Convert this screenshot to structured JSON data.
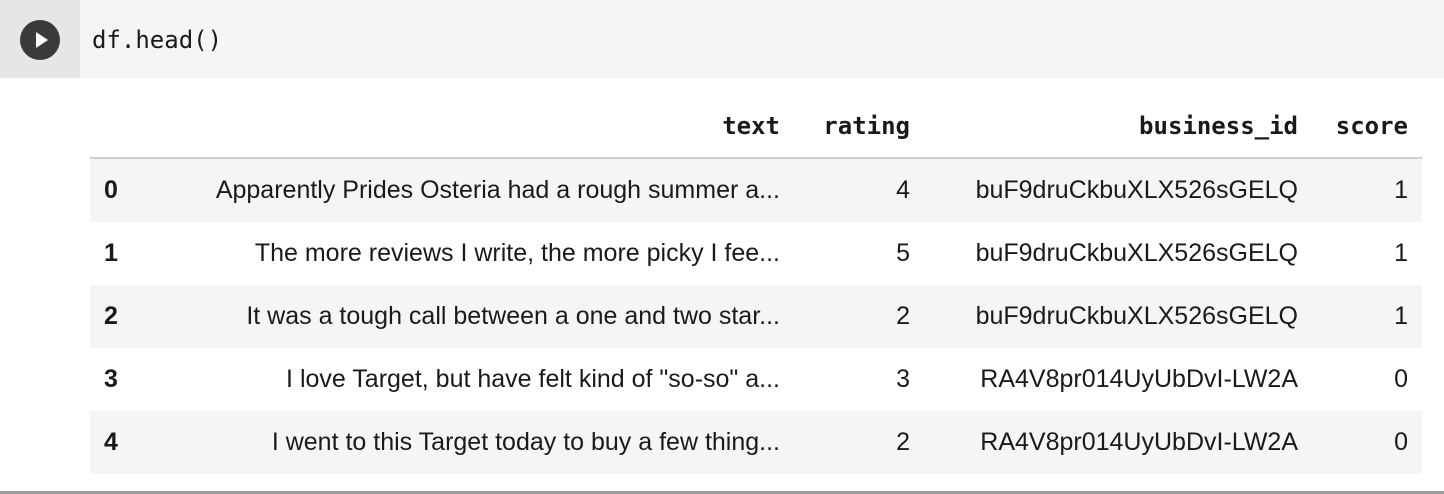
{
  "cell": {
    "code": "df.head()",
    "run_icon": "play-icon"
  },
  "table": {
    "columns": [
      "text",
      "rating",
      "business_id",
      "score"
    ],
    "rows": [
      {
        "index": "0",
        "text": "Apparently Prides Osteria had a rough summer a...",
        "rating": "4",
        "business_id": "buF9druCkbuXLX526sGELQ",
        "score": "1"
      },
      {
        "index": "1",
        "text": "The more reviews I write, the more picky I fee...",
        "rating": "5",
        "business_id": "buF9druCkbuXLX526sGELQ",
        "score": "1"
      },
      {
        "index": "2",
        "text": "It was a tough call between a one and two star...",
        "rating": "2",
        "business_id": "buF9druCkbuXLX526sGELQ",
        "score": "1"
      },
      {
        "index": "3",
        "text": "I love Target, but have felt kind of \"so-so\" a...",
        "rating": "3",
        "business_id": "RA4V8pr014UyUbDvI-LW2A",
        "score": "0"
      },
      {
        "index": "4",
        "text": "I went to this Target today to buy a few thing...",
        "rating": "2",
        "business_id": "RA4V8pr014UyUbDvI-LW2A",
        "score": "0"
      }
    ]
  },
  "colors": {
    "input_bg": "#f5f5f5",
    "gutter_bg": "#e6e6e6",
    "run_button": "#3a3a3a",
    "striped_row": "#f5f5f5"
  }
}
